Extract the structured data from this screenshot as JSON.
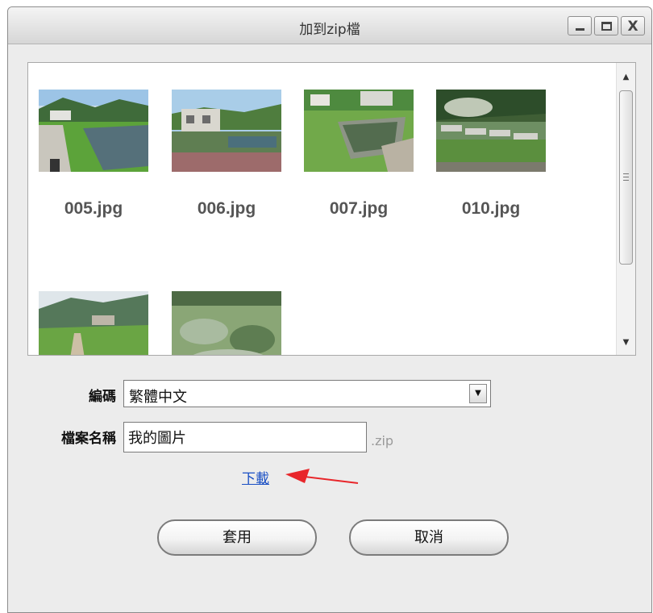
{
  "window": {
    "title": "加到zip檔",
    "minimize_icon": "minimize-icon",
    "maximize_icon": "maximize-icon",
    "close_icon": "close-icon",
    "close_glyph": "X"
  },
  "thumbnails": [
    {
      "label": "005.jpg",
      "scene": "lawn-and-pond"
    },
    {
      "label": "006.jpg",
      "scene": "building-by-pond"
    },
    {
      "label": "007.jpg",
      "scene": "garden-pond"
    },
    {
      "label": "010.jpg",
      "scene": "stream-with-stones"
    },
    {
      "label": "",
      "scene": "hillside-path"
    },
    {
      "label": "",
      "scene": "wetland-plants"
    }
  ],
  "scrollbar": {
    "up_glyph": "▲",
    "down_glyph": "▼"
  },
  "form": {
    "encoding_label": "編碼",
    "encoding_value": "繁體中文",
    "dropdown_glyph": "▼",
    "filename_label": "檔案名稱",
    "filename_value": "我的圖片",
    "filename_suffix": ".zip",
    "download_link": "下載"
  },
  "buttons": {
    "apply": "套用",
    "cancel": "取消"
  },
  "colors": {
    "link": "#1a4fc4",
    "annotation_arrow": "#e8262a"
  }
}
